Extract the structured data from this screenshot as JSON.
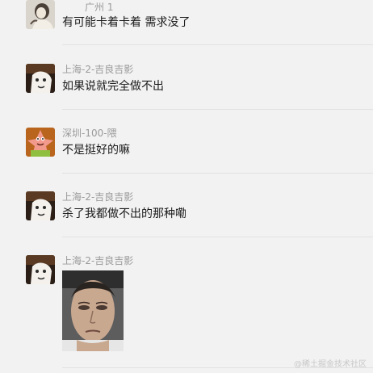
{
  "messages": [
    {
      "sender": "广州 1",
      "text": "有可能卡着卡着 需求没了",
      "avatar": "sketch-girl-avatar"
    },
    {
      "sender": "上海-2-吉良吉影",
      "text": "如果说就完全做不出",
      "avatar": "fist-cartoon-avatar"
    },
    {
      "sender": "深圳-100-隈",
      "text": "不是挺好的嘛",
      "avatar": "patrick-star-avatar"
    },
    {
      "sender": "上海-2-吉良吉影",
      "text": "杀了我都做不出的那种嘞",
      "avatar": "fist-cartoon-avatar"
    },
    {
      "sender": "上海-2-吉良吉影",
      "sticker": "tired-face-sticker",
      "avatar": "fist-cartoon-avatar"
    }
  ],
  "watermark": "@稀土掘金技术社区",
  "colors": {
    "background": "#f2f2f2",
    "sender_text": "#9a9a9a",
    "message_text": "#1b1b1b",
    "divider": "#e2e2e2"
  }
}
